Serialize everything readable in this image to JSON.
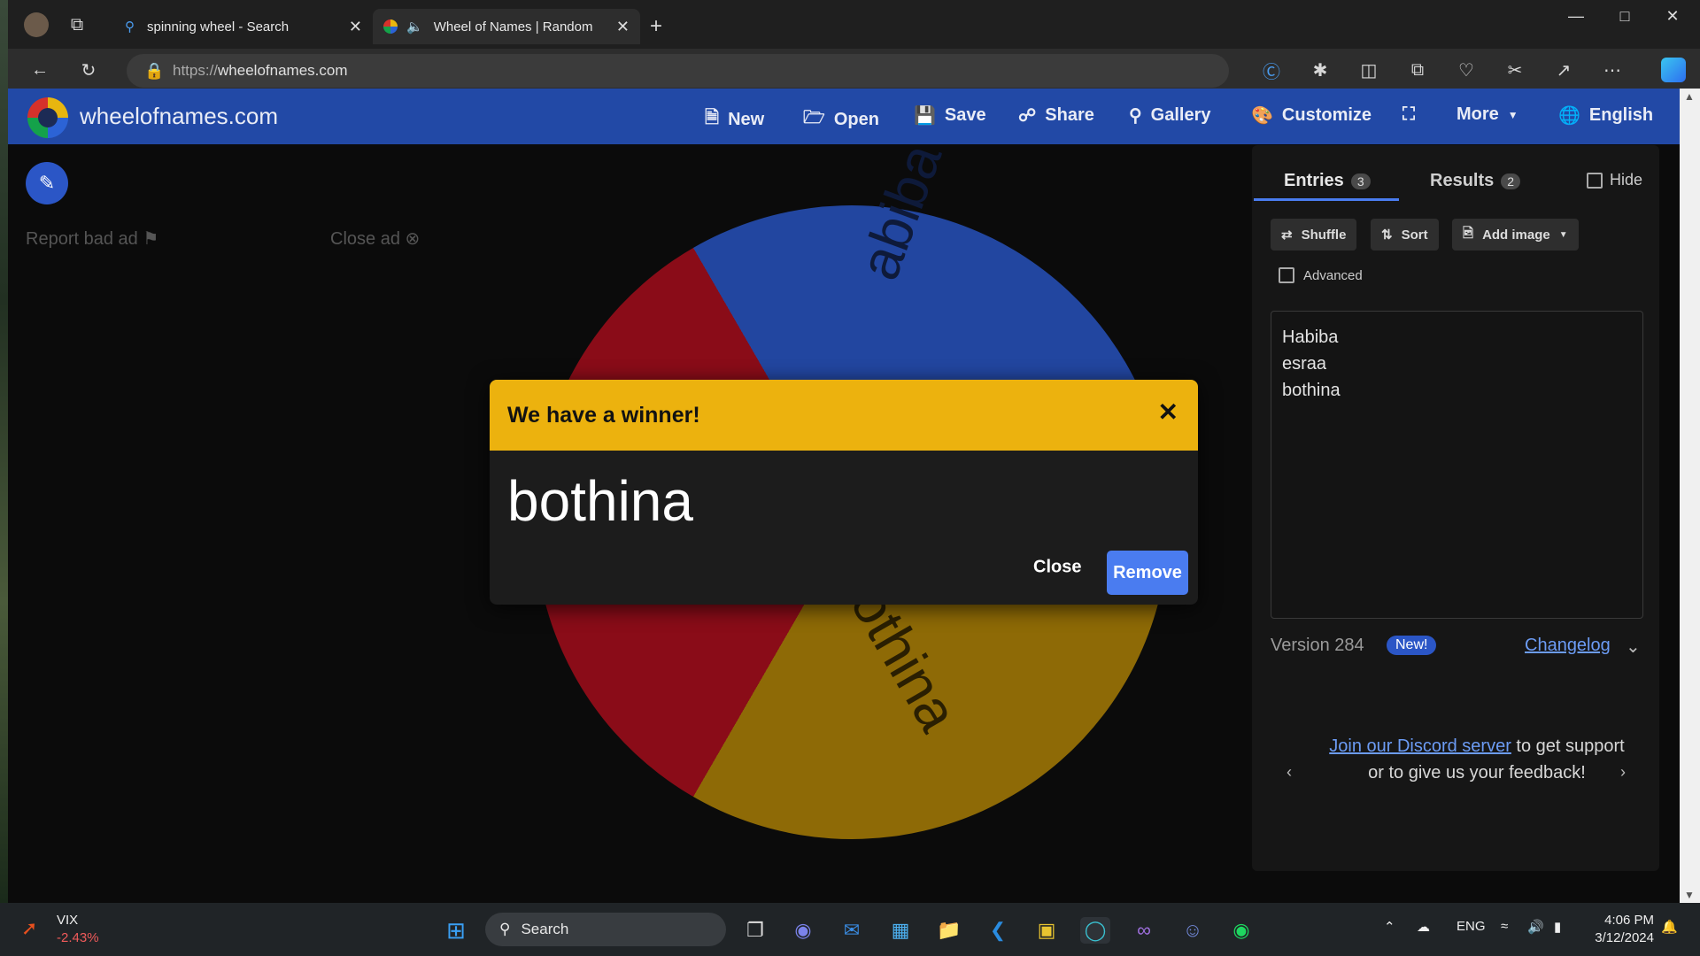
{
  "browser": {
    "tabs": [
      {
        "title": "spinning wheel - Search",
        "active": false
      },
      {
        "title": "Wheel of Names | Random",
        "active": true
      }
    ],
    "url_scheme": "https://",
    "url_host": "wheelofnames.com",
    "new_tab_label": "+"
  },
  "site": {
    "title": "wheelofnames.com",
    "nav": {
      "new": "New",
      "open": "Open",
      "save": "Save",
      "share": "Share",
      "gallery": "Gallery",
      "customize": "Customize",
      "more": "More",
      "language": "English"
    }
  },
  "left": {
    "report_ad": "Report bad ad",
    "close_ad": "Close ad"
  },
  "wheel": {
    "labels": [
      "Habiba",
      "esraa",
      "bothina"
    ],
    "visible_label_top": "abiba",
    "visible_label_bottom": "othina",
    "colors": {
      "blue": "#2246a0",
      "gold": "#8e6a06",
      "red": "#8a0c18"
    }
  },
  "dialog": {
    "title": "We have a winner!",
    "winner": "bothina",
    "close_label": "Close",
    "remove_label": "Remove",
    "header_color": "#ecb20e"
  },
  "panel": {
    "tab_entries": "Entries",
    "entries_count": "3",
    "tab_results": "Results",
    "results_count": "2",
    "hide_label": "Hide",
    "shuffle": "Shuffle",
    "sort": "Sort",
    "add_image": "Add image",
    "advanced": "Advanced",
    "entries": [
      "Habiba",
      "esraa",
      "bothina"
    ],
    "version": "Version 284",
    "new_badge": "New!",
    "changelog": "Changelog",
    "discord_link": "Join our Discord server",
    "discord_text": " to get support or to give us your feedback!"
  },
  "taskbar": {
    "ticker_symbol": "VIX",
    "ticker_change": "-2.43%",
    "search_label": "Search",
    "language": "ENG",
    "time": "4:06 PM",
    "date": "3/12/2024"
  }
}
